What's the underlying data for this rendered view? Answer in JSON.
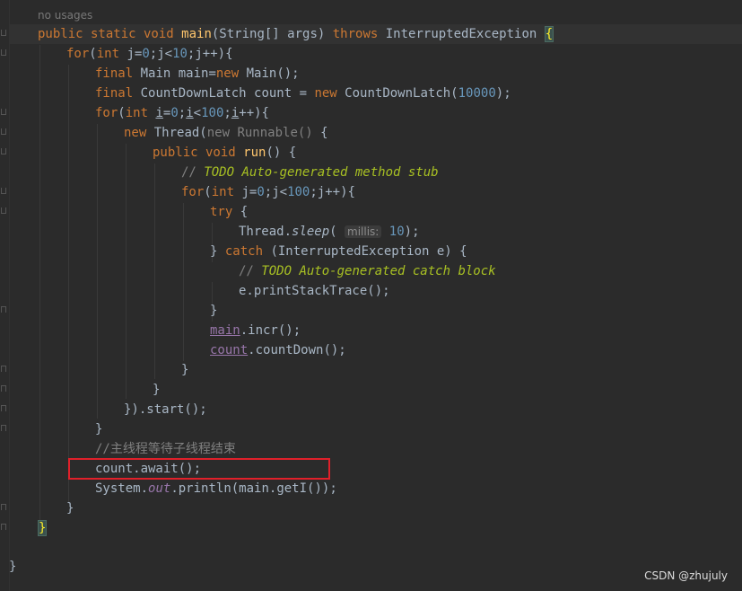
{
  "editor": {
    "usage_hint": "no usages",
    "lines": {
      "l1_mods": "public static void ",
      "l1_fn": "main",
      "l1_params": "(String[] args) ",
      "l1_throws": "throws",
      "l1_exc": " InterruptedException ",
      "l1_brace": "{",
      "l2_for": "for",
      "l2_int": "int",
      "l2_j": " j=",
      "l2_0": "0",
      "l2_cond": ";j<",
      "l2_10": "10",
      "l2_end": ";j++){",
      "l3_final": "final",
      "l3_mid": " Main main=",
      "l3_new": "new",
      "l3_end": " Main();",
      "l4_final": "final",
      "l4_mid": " CountDownLatch count = ",
      "l4_new": "new",
      "l4_ctor": " CountDownLatch(",
      "l4_num": "10000",
      "l4_end": ");",
      "l5_for": "for",
      "l5_int": "int",
      "l5_i": "i",
      "l5_eq": "=",
      "l5_0": "0",
      "l5_semi": ";",
      "l5_i2": "i",
      "l5_lt": "<",
      "l5_100": "100",
      "l5_semi2": ";",
      "l5_i3": "i",
      "l5_end": "++){",
      "l6_new": "new",
      "l6_thread": " Thread(",
      "l6_anon": "new Runnable()",
      "l6_end": " {",
      "l7_public": "public void ",
      "l7_fn": "run",
      "l7_end": "() {",
      "l8_cm": "// ",
      "l8_todo": "TODO Auto-generated method stub",
      "l9_for": "for",
      "l9_int": "int",
      "l9_j": " j=",
      "l9_0": "0",
      "l9_cond": ";j<",
      "l9_100": "100",
      "l9_end": ";j++){",
      "l10_try": "try",
      "l10_end": " {",
      "l11_thread": "Thread.",
      "l11_sleep": "sleep",
      "l11_open": "( ",
      "l11_hint": "millis:",
      "l11_num": "10",
      "l11_end": ");",
      "l12_close": "} ",
      "l12_catch": "catch",
      "l12_end": " (InterruptedException e) {",
      "l13_cm": "// ",
      "l13_todo": "TODO Auto-generated catch block",
      "l14_text": "e.printStackTrace();",
      "l15_text": "}",
      "l16_field": "main",
      "l16_end": ".incr();",
      "l17_field": "count",
      "l17_end": ".countDown();",
      "l18_text": "}",
      "l19_text": "}",
      "l20_text": "}).start();",
      "l21_text": "}",
      "l22_cm": "//主线程等待子线程结束",
      "l23_text": "count.await();",
      "l24_sys": "System.",
      "l24_out": "out",
      "l24_end": ".println(main.getI());",
      "l25_text": "}",
      "l26_brace": "}",
      "l27_text": "}"
    }
  },
  "watermark": "CSDN @zhujuly",
  "colors": {
    "background": "#2b2b2b",
    "keyword": "#cc7832",
    "function": "#ffc66d",
    "number": "#6897bb",
    "comment": "#808080",
    "todo": "#a8c023",
    "field": "#9876aa",
    "highlight_box": "#e0202a"
  }
}
